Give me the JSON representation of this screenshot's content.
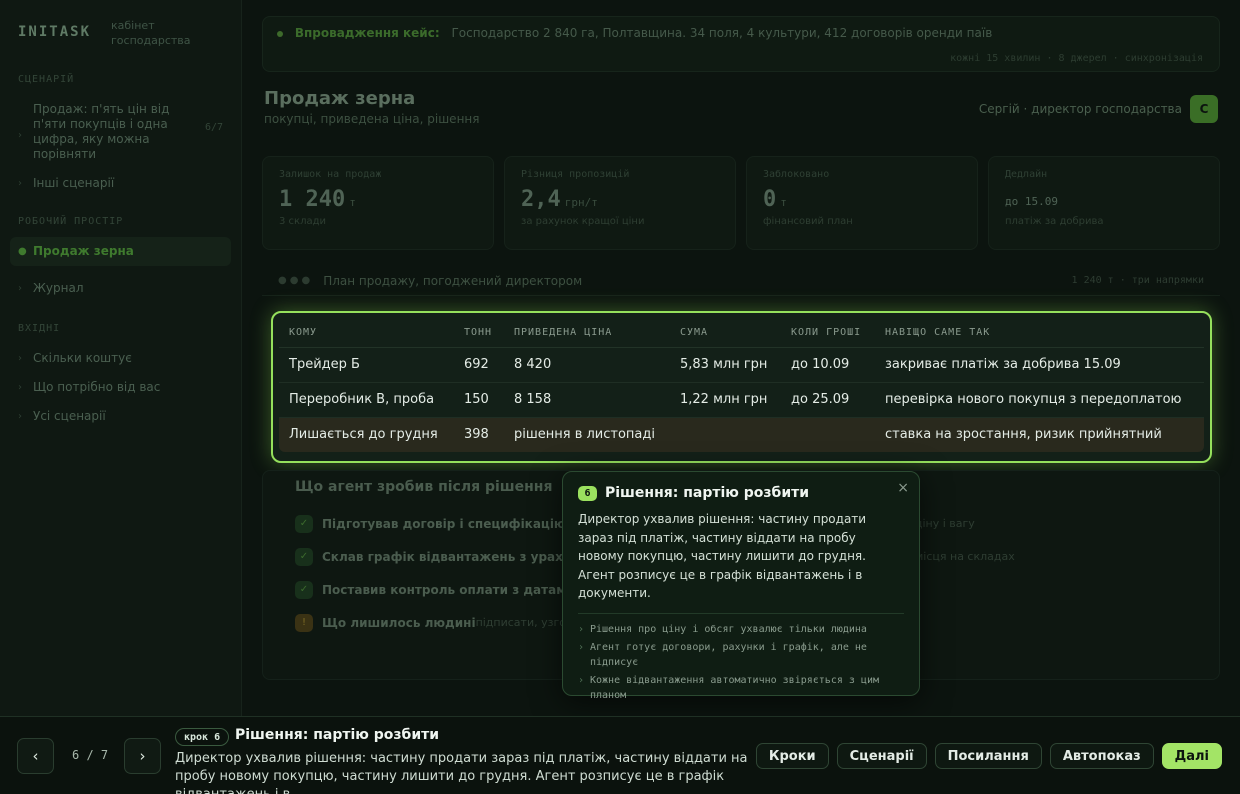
{
  "sidebar": {
    "brand": "INITASK",
    "brand_sub": "кабінет\nгосподарства",
    "section_scenario": "СЦЕНАРІЙ",
    "scenario_item": "Продаж: п'ять цін від п'яти покупців і одна цифра, яку можна порівняти",
    "scenario_count": "6/7",
    "other_scenarios": "Інші сценарії",
    "section_workspace": "РОБОЧИЙ ПРОСТІР",
    "workspace_items": [
      "Продаж зерна",
      "Журнал"
    ],
    "section_links": "ВХІДНІ",
    "link_items": [
      "Скільки коштує",
      "Що потрібно від вас",
      "Усі сценарії"
    ]
  },
  "banner": {
    "title": "Впровадження кейс:",
    "text": "Господарство 2 840 га, Полтавщина. 34 поля, 4 культури, 412 договорів оренди паїв",
    "note": "кожні 15 хвилин · 8 джерел · синхронізація"
  },
  "header": {
    "title": "Продаж зерна",
    "subtitle": "покупці, приведена ціна, рішення",
    "user_name": "Сергій · директор господарства",
    "avatar": "С"
  },
  "kpis": [
    {
      "label": "Залишок на продаж",
      "value": "1 240",
      "unit": "т",
      "note": "3 склади"
    },
    {
      "label": "Різниця пропозицій",
      "value": "2,4",
      "unit": "грн/т",
      "note": "за рахунок кращої ціни"
    },
    {
      "label": "Заблоковано",
      "value": "0",
      "unit": "т",
      "note": "фінансовий план"
    },
    {
      "label": "Дедлайн",
      "value": "до 15.09",
      "unit": "",
      "note": "платіж за добрива"
    }
  ],
  "plan": {
    "title": "План продажу, погоджений директором",
    "right": "1 240 т · три напрямки"
  },
  "table": {
    "headers": [
      "КОМУ",
      "ТОНН",
      "ПРИВЕДЕНА ЦІНА",
      "СУМА",
      "КОЛИ ГРОШІ",
      "НАВІЩО САМЕ ТАК"
    ],
    "rows": [
      [
        "Трейдер Б",
        "692",
        "8 420",
        "5,83 млн грн",
        "до 10.09",
        "закриває платіж за добрива 15.09"
      ],
      [
        "Переробник В, проба",
        "150",
        "8 158",
        "1,22 млн грн",
        "до 25.09",
        "перевірка нового покупця з передоплатою"
      ],
      [
        "Лишається до грудня",
        "398",
        "рішення в листопаді",
        "",
        "",
        "ставка на зростання, ризик прийнятний"
      ]
    ]
  },
  "agent": {
    "title": "Що агент зробив після рішення",
    "items": [
      {
        "label": "Підготував договір і специфікацію",
        "extra": "",
        "tail": "ціну і вагу"
      },
      {
        "label": "Склав графік відвантажень з урахуванням",
        "extra": "",
        "tail": "місця на складах"
      },
      {
        "label": "Поставив контроль оплати з датами",
        "extra": "",
        "tail": ""
      },
      {
        "label": "Що лишилось людині",
        "extra": "підписати, узгодити",
        "tail": ""
      }
    ]
  },
  "popover": {
    "num": "6",
    "title": "Рішення: партію розбити",
    "body": "Директор ухвалив рішення: частину продати зараз під платіж, частину віддати на пробу новому покупцю, частину лишити до грудня. Агент розписує це в графік відвантажень і в документи.",
    "notes": [
      "Рішення про ціну і обсяг ухвалює тільки людина",
      "Агент готує договори, рахунки і графік, але не підписує",
      "Кожне відвантаження автоматично звіряється з цим планом"
    ],
    "close": "×"
  },
  "footer": {
    "prev": "‹",
    "next": "›",
    "step_count": "6 / 7",
    "step_badge": "крок 6",
    "step_title": "Рішення: партію розбити",
    "step_desc": "Директор ухвалив рішення: частину продати зараз під платіж, частину віддати на пробу новому покупцю, частину лишити до грудня. Агент розписує це в графік відвантажень і в...",
    "buttons": [
      "Кроки",
      "Сценарії",
      "Посилання",
      "Автопоказ",
      "Далі"
    ]
  },
  "colors": {
    "accent": "#9be15f",
    "background": "#0c140f",
    "highlight_row": "#29291d"
  }
}
